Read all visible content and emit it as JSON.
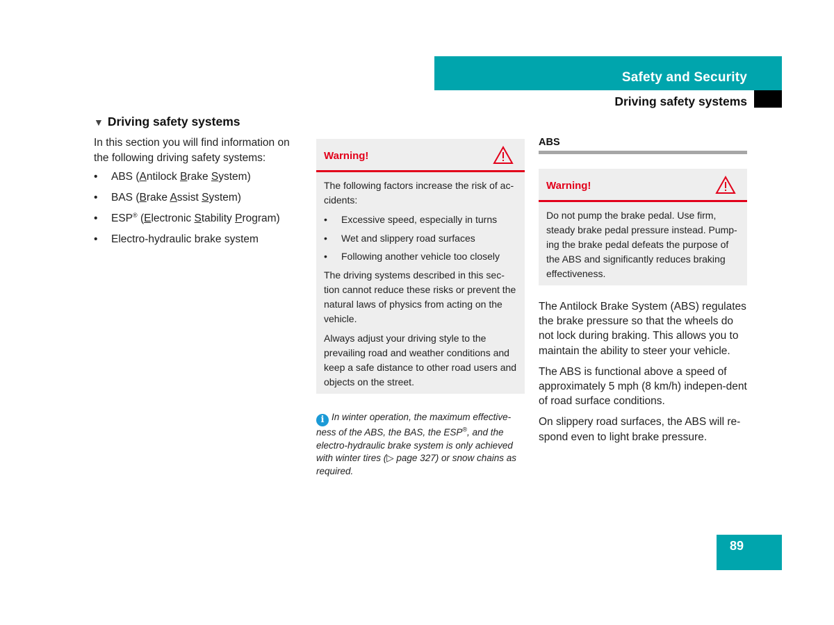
{
  "header": {
    "chapter_title": "Safety and Security",
    "section_title": "Driving safety systems",
    "accent_color": "#00a5ad"
  },
  "column1": {
    "heading": "Driving safety systems",
    "heading_icon": "triangle-down-icon",
    "intro": "In this section you will find information on the following driving safety systems:",
    "items": [
      {
        "prefix": "ABS (",
        "parts": [
          [
            "A",
            "ntilock "
          ],
          [
            "B",
            "rake "
          ],
          [
            "S",
            "ystem)"
          ]
        ]
      },
      {
        "prefix": "BAS (",
        "parts": [
          [
            "B",
            "rake "
          ],
          [
            "A",
            "ssist "
          ],
          [
            "S",
            "ystem)"
          ]
        ]
      },
      {
        "prefix": "ESP",
        "sup": "®",
        "mid": " (",
        "parts": [
          [
            "E",
            "lectronic "
          ],
          [
            "S",
            "tability "
          ],
          [
            "P",
            "rogram)"
          ]
        ]
      },
      {
        "text": "Electro-hydraulic brake system"
      }
    ]
  },
  "warning1": {
    "label": "Warning!",
    "icon": "warning-triangle-icon",
    "accent_color": "#e2001a",
    "intro": "The following factors increase the risk of ac-cidents:",
    "items": [
      "Excessive speed, especially in turns",
      "Wet and slippery road surfaces",
      "Following another vehicle too closely"
    ],
    "para1": "The driving systems described in this sec-tion cannot reduce these risks or prevent the natural laws of physics from acting on the vehicle.",
    "para2": "Always adjust your driving style to the prevailing road and weather conditions and keep a safe distance to other road users and objects on the street."
  },
  "info_note": {
    "icon": "info-icon",
    "text_before_sup": "In winter operation, the maximum effective-ness of the ABS, the BAS, the ESP",
    "sup": "®",
    "text_after_sup": ", and the electro-hydraulic brake system is only achieved with winter tires (▷ page 327) or snow chains as required."
  },
  "abs": {
    "heading": "ABS",
    "warning": {
      "label": "Warning!",
      "icon": "warning-triangle-icon",
      "text": "Do not pump the brake pedal. Use firm, steady brake pedal pressure instead. Pump-ing the brake pedal defeats the purpose of the ABS and significantly reduces braking effectiveness."
    },
    "paragraphs": [
      "The Antilock Brake System (ABS) regulates the brake pressure so that the wheels do not lock during braking. This allows you to maintain the ability to steer your vehicle.",
      "The ABS is functional above a speed of approximately 5 mph (8 km/h) indepen-dent of road surface conditions.",
      "On slippery road surfaces, the ABS will re-spond even to light brake pressure."
    ]
  },
  "footer": {
    "page_number": "89"
  }
}
